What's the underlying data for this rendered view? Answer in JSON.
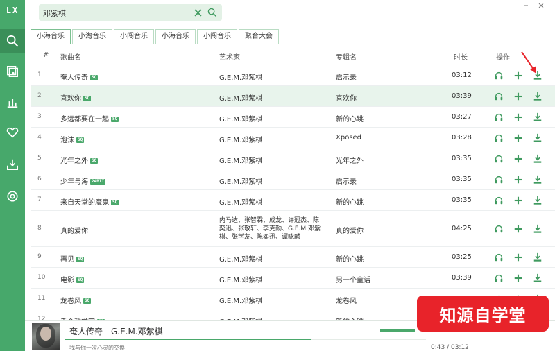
{
  "app": {
    "logo": "LX"
  },
  "colors": {
    "accent": "#4aa86b",
    "sidebar": "#47a86b",
    "highlight_row": "#e8f4ec",
    "watermark": "#e8232a"
  },
  "sidebar": {
    "items": [
      {
        "icon": "search-icon",
        "active": true
      },
      {
        "icon": "playlist-icon",
        "active": false
      },
      {
        "icon": "chart-icon",
        "active": false
      },
      {
        "icon": "heart-icon",
        "active": false
      },
      {
        "icon": "download-icon",
        "active": false
      },
      {
        "icon": "settings-icon",
        "active": false
      }
    ]
  },
  "search": {
    "value": "邓紫棋"
  },
  "tabs": [
    {
      "label": "小海音乐",
      "active": true
    },
    {
      "label": "小淘音乐",
      "active": false
    },
    {
      "label": "小闯音乐",
      "active": false
    },
    {
      "label": "小海音乐",
      "active": false
    },
    {
      "label": "小闯音乐",
      "active": false
    },
    {
      "label": "聚合大会",
      "active": false
    }
  ],
  "table": {
    "headers": {
      "index": "#",
      "name": "歌曲名",
      "artist": "艺术家",
      "album": "专辑名",
      "duration": "时长",
      "ops": "操作"
    },
    "rows": [
      {
        "num": "1",
        "name": "奄人传奇",
        "badge": "SQ",
        "artist": "G.E.M.邓紫棋",
        "album": "启示录",
        "duration": "03:12"
      },
      {
        "num": "2",
        "name": "喜欢你",
        "badge": "SQ",
        "artist": "G.E.M.邓紫棋",
        "album": "喜欢你",
        "duration": "03:39"
      },
      {
        "num": "3",
        "name": "多远都要在一起",
        "badge": "SQ",
        "artist": "G.E.M.邓紫棋",
        "album": "新的心跳",
        "duration": "03:27"
      },
      {
        "num": "4",
        "name": "泡沫",
        "badge": "SQ",
        "artist": "G.E.M.邓紫棋",
        "album": "Xposed",
        "duration": "03:28"
      },
      {
        "num": "5",
        "name": "光年之外",
        "badge": "SQ",
        "artist": "G.E.M.邓紫棋",
        "album": "光年之外",
        "duration": "03:35"
      },
      {
        "num": "6",
        "name": "少年与海",
        "badge": "24BIT",
        "artist": "G.E.M.邓紫棋",
        "album": "启示录",
        "duration": "03:35"
      },
      {
        "num": "7",
        "name": "来自天堂的魔鬼",
        "badge": "SQ",
        "artist": "G.E.M.邓紫棋",
        "album": "新的心跳",
        "duration": "03:35"
      },
      {
        "num": "8",
        "name": "真的爱你",
        "badge": "",
        "artist": "内马达、张智霖、成龙、许冠杰、陈奕迅、张敬轩、李克勤、G.E.M.邓紫棋、张学友、陈奕迅、谭咏麟",
        "album": "真的爱你",
        "duration": "04:25"
      },
      {
        "num": "9",
        "name": "再见",
        "badge": "SQ",
        "artist": "G.E.M.邓紫棋",
        "album": "新的心跳",
        "duration": "03:25"
      },
      {
        "num": "10",
        "name": "电影",
        "badge": "SQ",
        "artist": "G.E.M.邓紫棋",
        "album": "另一个童话",
        "duration": "03:39"
      },
      {
        "num": "11",
        "name": "龙卷风",
        "badge": "SQ",
        "artist": "G.E.M.邓紫棋",
        "album": "龙卷风",
        "duration": ""
      },
      {
        "num": "12",
        "name": "千个哲学家",
        "badge": "SQ",
        "artist": "G.E.M.邓紫棋",
        "album": "新的心跳",
        "duration": ""
      }
    ]
  },
  "player": {
    "title": "奄人传奇 - G.E.M.邓紫棋",
    "lyric": "我与你一次心灵的交换",
    "time": "0:43 / 03:12",
    "progress": 0.68
  },
  "watermark": {
    "text": "知源自学堂"
  }
}
